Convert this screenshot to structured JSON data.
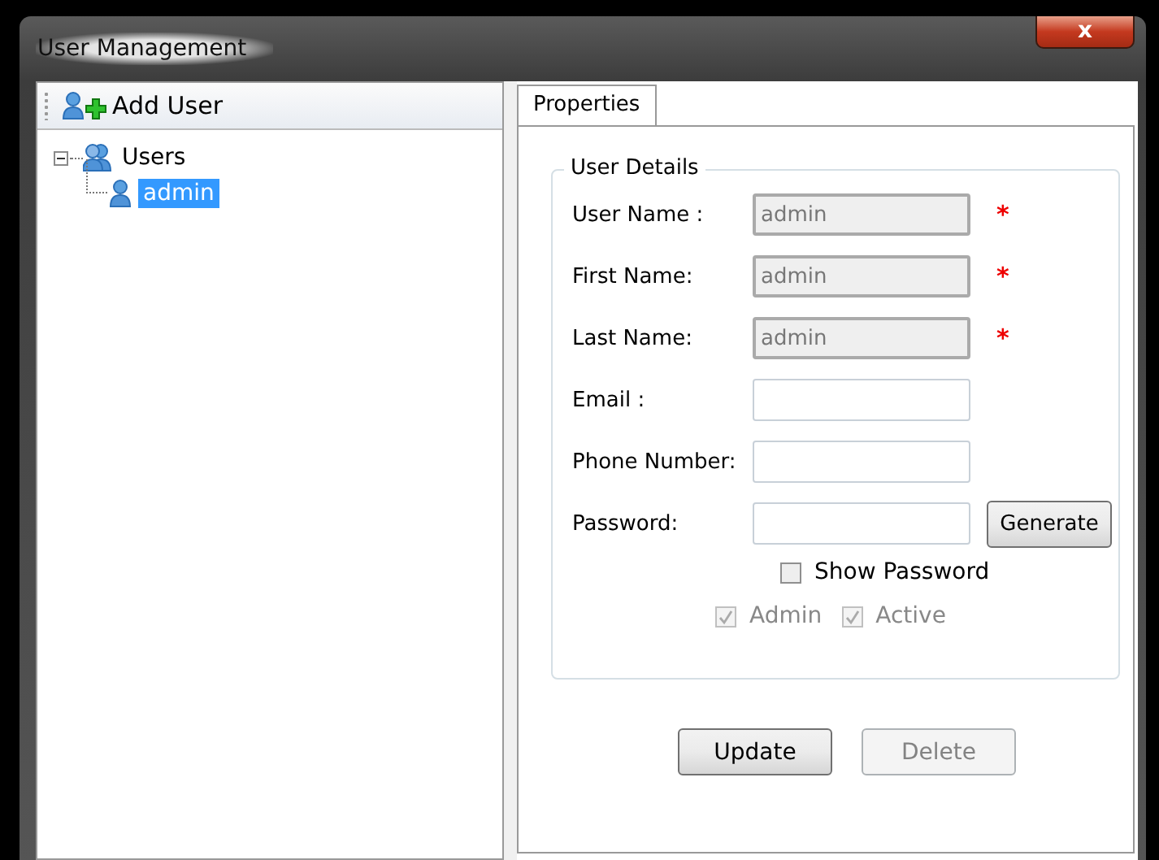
{
  "window": {
    "title": "User Management",
    "close": "x"
  },
  "toolbar": {
    "add_button": "Add User"
  },
  "tree": [
    {
      "label": "Users",
      "kind": "group",
      "expanded": true,
      "selected": false,
      "children": [
        {
          "label": "admin",
          "kind": "user",
          "selected": true
        }
      ]
    }
  ],
  "tabs": [
    {
      "label": "Properties",
      "selected": true
    }
  ],
  "group": {
    "title": "User Details",
    "fields": [
      {
        "label": "User Name :",
        "value": "admin",
        "disabled": true,
        "marker": "*"
      },
      {
        "label": "First Name:",
        "value": "admin",
        "disabled": true,
        "marker": "*"
      },
      {
        "label": "Last Name:",
        "value": "admin",
        "disabled": true,
        "marker": "*"
      },
      {
        "label": "Email :",
        "disabled": false
      },
      {
        "label": "Phone Number:",
        "disabled": false
      },
      {
        "label": "Password:",
        "disabled": false,
        "button": "Generate"
      }
    ],
    "show_password": {
      "label": "Show Password",
      "checked": false,
      "disabled": false
    },
    "flags": [
      {
        "label": "Admin",
        "checked": true,
        "disabled": true
      },
      {
        "label": "Active",
        "checked": true,
        "disabled": true
      }
    ]
  },
  "buttons": [
    {
      "label": "Update",
      "disabled": false
    },
    {
      "label": "Delete",
      "disabled": true
    }
  ]
}
